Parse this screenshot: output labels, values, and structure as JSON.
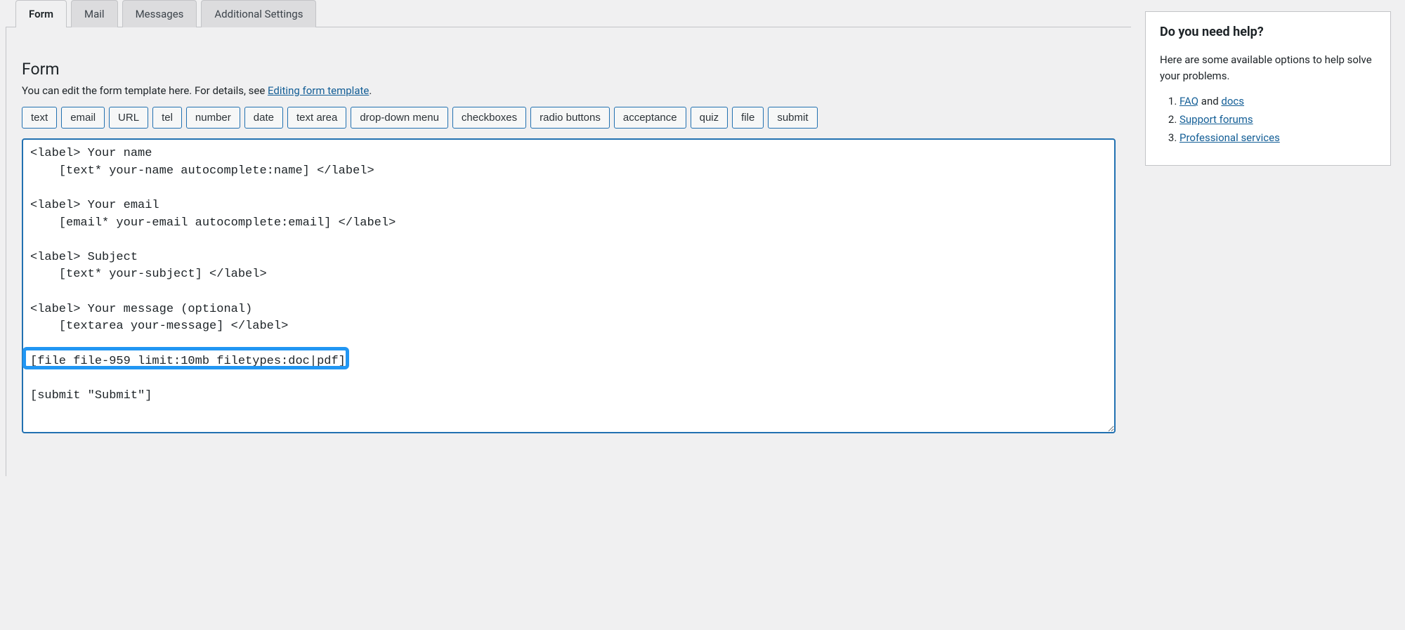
{
  "tabs": [
    {
      "label": "Form",
      "active": true
    },
    {
      "label": "Mail",
      "active": false
    },
    {
      "label": "Messages",
      "active": false
    },
    {
      "label": "Additional Settings",
      "active": false
    }
  ],
  "section": {
    "title": "Form",
    "description_prefix": "You can edit the form template here. For details, see ",
    "description_link": "Editing form template",
    "description_suffix": "."
  },
  "tag_buttons": [
    "text",
    "email",
    "URL",
    "tel",
    "number",
    "date",
    "text area",
    "drop-down menu",
    "checkboxes",
    "radio buttons",
    "acceptance",
    "quiz",
    "file",
    "submit"
  ],
  "form_template": "<label> Your name\n    [text* your-name autocomplete:name] </label>\n\n<label> Your email\n    [email* your-email autocomplete:email] </label>\n\n<label> Subject\n    [text* your-subject] </label>\n\n<label> Your message (optional)\n    [textarea your-message] </label>\n\n[file file-959 limit:10mb filetypes:doc|pdf]\n\n[submit \"Submit\"]",
  "highlighted_line": "[file file-959 limit:10mb filetypes:doc|pdf]",
  "help_box": {
    "title": "Do you need help?",
    "intro": "Here are some available options to help solve your problems.",
    "items": [
      {
        "link1": "FAQ",
        "mid": " and ",
        "link2": "docs"
      },
      {
        "link1": "Support forums"
      },
      {
        "link1": "Professional services"
      }
    ]
  }
}
